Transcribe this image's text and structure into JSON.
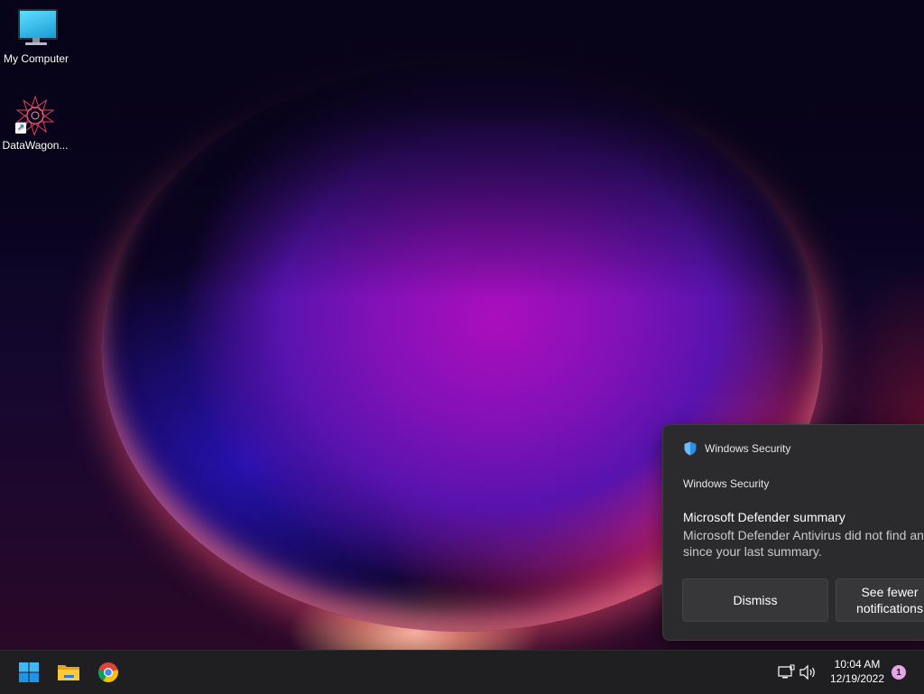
{
  "desktop": {
    "icons": [
      {
        "label": "My Computer",
        "icon": "monitor-icon"
      },
      {
        "label": "DataWagon...",
        "icon": "datawagon-app-icon"
      }
    ]
  },
  "taskbar": {
    "apps": [
      {
        "name": "Start",
        "icon": "windows-start-icon"
      },
      {
        "name": "File Explorer",
        "icon": "file-explorer-icon"
      },
      {
        "name": "Google Chrome",
        "icon": "chrome-icon"
      }
    ],
    "tray": {
      "network_icon": "network-icon",
      "volume_icon": "volume-icon",
      "time": "10:04 AM",
      "date": "12/19/2022",
      "notification_count": "1"
    }
  },
  "toast": {
    "app_name": "Windows Security",
    "subtitle": "Windows Security",
    "title": "Microsoft Defender summary",
    "body_line1": "Microsoft Defender Antivirus did not find any",
    "body_line2": "since your last summary.",
    "buttons": {
      "dismiss": "Dismiss",
      "see_fewer_line1": "See fewer",
      "see_fewer_line2": "notifications"
    }
  },
  "colors": {
    "taskbar_bg": "#1f1f22",
    "toast_bg": "#2b2b2d",
    "badge": "#e5a6e6"
  }
}
